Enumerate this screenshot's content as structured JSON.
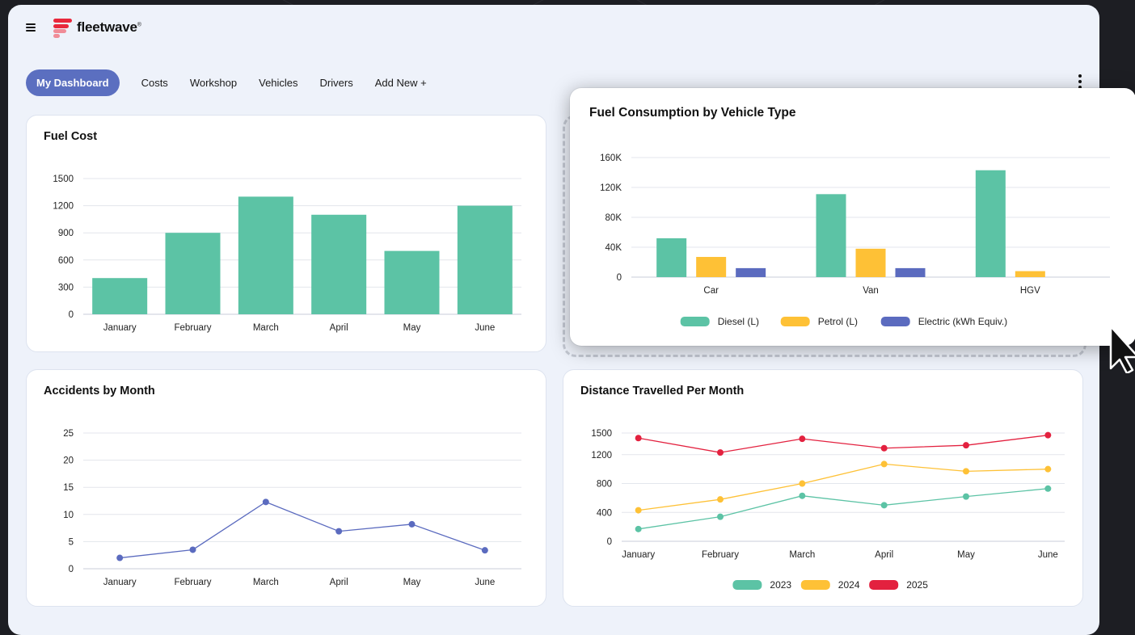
{
  "app": {
    "brand": "fleetwave",
    "trademark": "®"
  },
  "nav": {
    "tabs": [
      "My Dashboard",
      "Costs",
      "Workshop",
      "Vehicles",
      "Drivers",
      "Add New +"
    ],
    "active": 0
  },
  "icons": {
    "menu": "hamburger-menu-icon",
    "more": "more-vertical-icon",
    "cursor": "mouse-pointer-icon"
  },
  "colors": {
    "accent": "#5b6fc0",
    "teal": "#5cc3a5",
    "amber": "#fec136",
    "indigo": "#5b6bbf",
    "red": "#e3213f",
    "logo_red": "#e8283c",
    "logo_pink": "#f08c97"
  },
  "charts": {
    "fuel_cost": {
      "title": "Fuel Cost"
    },
    "accidents": {
      "title": "Accidents by Month"
    },
    "distance": {
      "title": "Distance Travelled Per Month"
    },
    "fuel_consumption": {
      "title": "Fuel Consumption by Vehicle Type"
    }
  },
  "chart_data": [
    {
      "id": "fuel_cost",
      "type": "bar",
      "title": "Fuel Cost",
      "categories": [
        "January",
        "February",
        "March",
        "April",
        "May",
        "June"
      ],
      "values": [
        400,
        900,
        1300,
        1100,
        700,
        1200
      ],
      "ylim": [
        0,
        1500
      ],
      "yticks": [
        0,
        300,
        600,
        900,
        1200,
        1500
      ],
      "ytick_labels": [
        "0",
        "300",
        "600",
        "900",
        "1200",
        "1500"
      ],
      "grid": true,
      "color": "#5cc3a5"
    },
    {
      "id": "accidents",
      "type": "line",
      "title": "Accidents by Month",
      "categories": [
        "January",
        "February",
        "March",
        "April",
        "May",
        "June"
      ],
      "values": [
        2,
        3.5,
        12.3,
        6.9,
        8.2,
        3.4
      ],
      "ylim": [
        0,
        25
      ],
      "yticks": [
        0,
        5,
        10,
        15,
        20,
        25
      ],
      "ytick_labels": [
        "0",
        "5",
        "10",
        "15",
        "20",
        "25"
      ],
      "grid": true,
      "color": "#5b6bbf"
    },
    {
      "id": "distance",
      "type": "line",
      "title": "Distance Travelled Per Month",
      "categories": [
        "January",
        "February",
        "March",
        "April",
        "May",
        "June"
      ],
      "series": [
        {
          "name": "2023",
          "values": [
            170,
            340,
            630,
            500,
            620,
            730
          ],
          "color": "#5cc3a5"
        },
        {
          "name": "2024",
          "values": [
            430,
            580,
            800,
            1070,
            970,
            1000
          ],
          "color": "#fec136"
        },
        {
          "name": "2025",
          "values": [
            1430,
            1230,
            1420,
            1290,
            1330,
            1470
          ],
          "color": "#e3213f"
        }
      ],
      "ylim": [
        0,
        1600
      ],
      "yticks": [
        0,
        400,
        800,
        1200,
        1500
      ],
      "ytick_labels": [
        "0",
        "400",
        "800",
        "1200",
        "1500"
      ],
      "grid": true,
      "legend": "bottom"
    },
    {
      "id": "fuel_consumption",
      "type": "bar",
      "title": "Fuel Consumption by Vehicle Type",
      "categories": [
        "Car",
        "Van",
        "HGV"
      ],
      "series": [
        {
          "name": "Diesel (L)",
          "values": [
            52000,
            111000,
            143000
          ],
          "color": "#5cc3a5"
        },
        {
          "name": "Petrol (L)",
          "values": [
            27000,
            38000,
            8000
          ],
          "color": "#fec136"
        },
        {
          "name": "Electric (kWh Equiv.)",
          "values": [
            12000,
            12000,
            0
          ],
          "color": "#5b6bbf"
        }
      ],
      "ylim": [
        0,
        160000
      ],
      "yticks": [
        0,
        40000,
        80000,
        120000,
        160000
      ],
      "ytick_labels": [
        "0",
        "40K",
        "80K",
        "120K",
        "160K"
      ],
      "grid": true,
      "legend": "bottom"
    }
  ]
}
